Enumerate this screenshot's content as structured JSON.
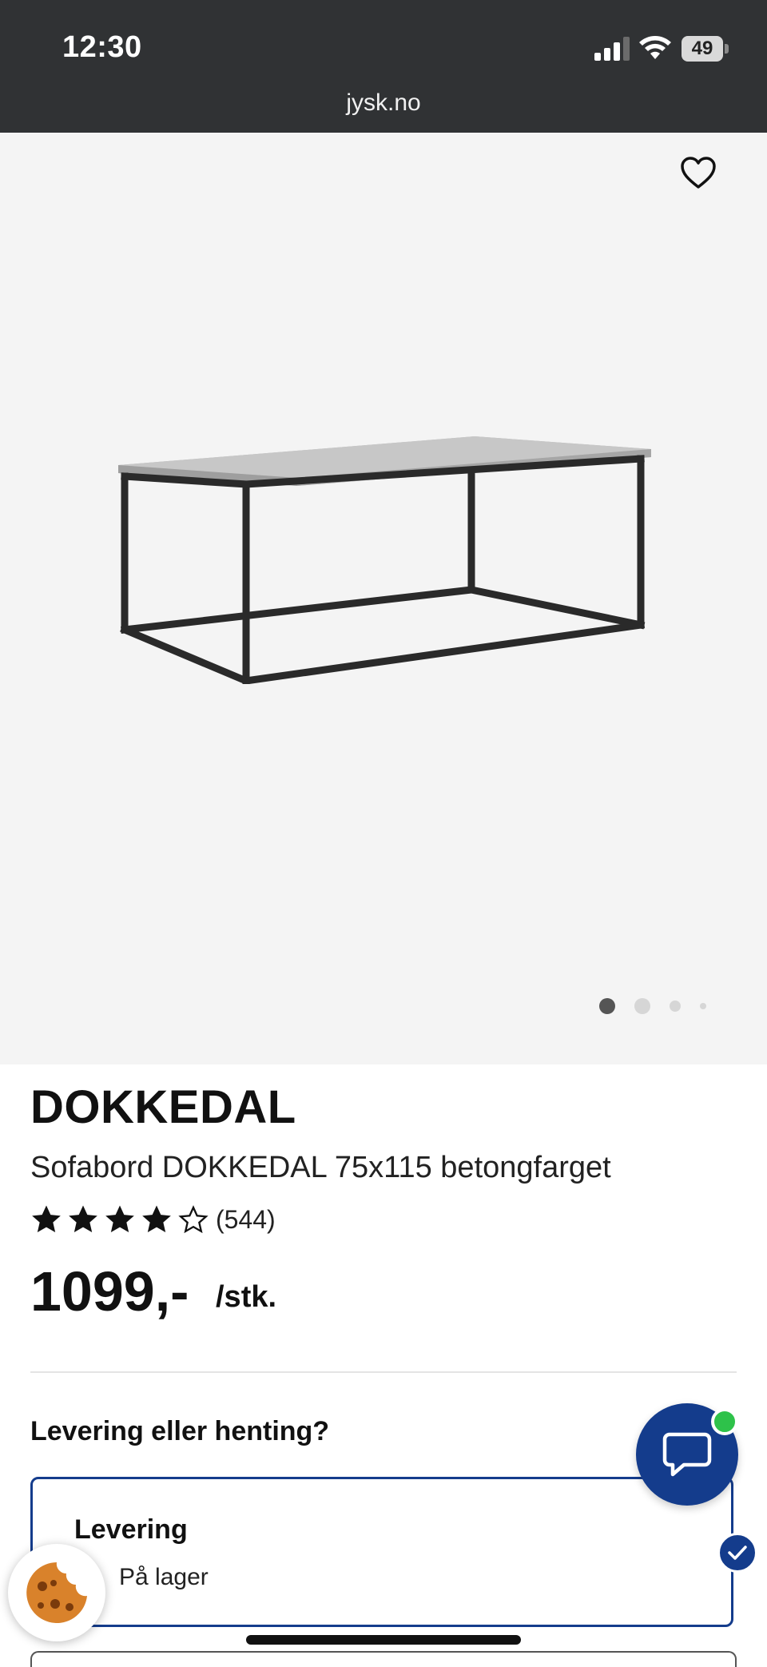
{
  "status_bar": {
    "time": "12:30",
    "battery": "49",
    "url": "jysk.no"
  },
  "gallery": {
    "favorite_icon": "heart-outline-icon",
    "image_alt": "Sofabord DOKKEDAL",
    "pagination": {
      "count": 4,
      "active": 1
    }
  },
  "product": {
    "brand": "DOKKEDAL",
    "name": "Sofabord DOKKEDAL 75x115 betongfarget",
    "rating": 4,
    "rating_max": 5,
    "review_count": "(544)",
    "price": "1099,-",
    "unit": "/stk."
  },
  "delivery": {
    "question": "Levering eller henting?",
    "option": {
      "title": "Levering",
      "stock": "På lager",
      "selected": true
    }
  },
  "floating": {
    "chat_icon": "chat-bubble-icon",
    "cookie_icon": "cookie-icon"
  },
  "colors": {
    "brand_blue": "#143c8c",
    "status_bar": "#303234",
    "online_green": "#2ec24a"
  }
}
